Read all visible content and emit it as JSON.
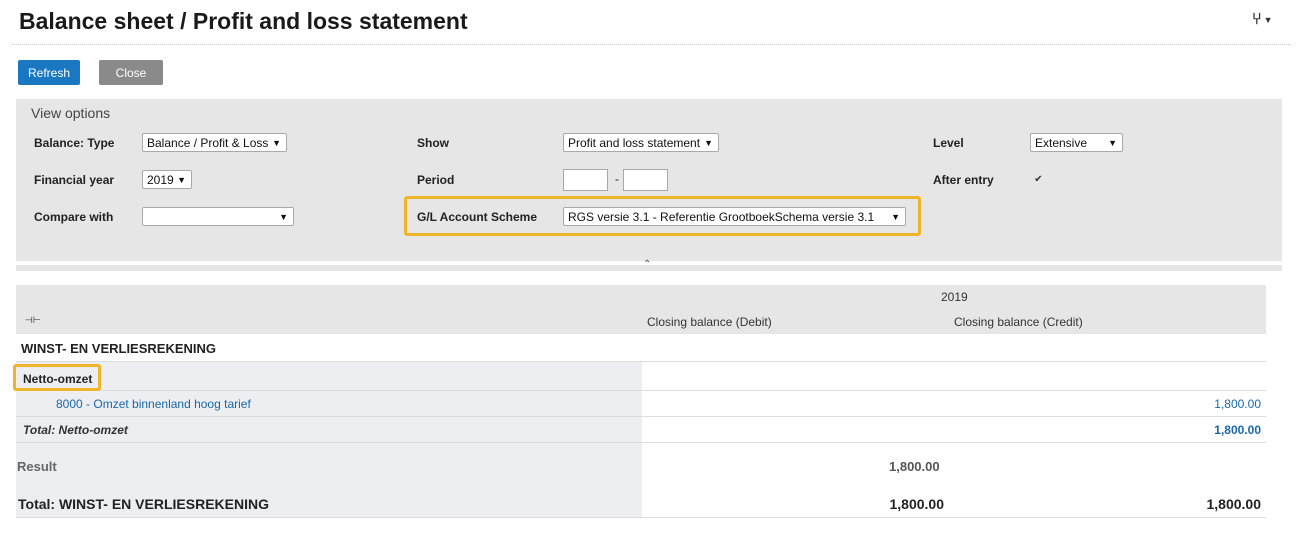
{
  "header": {
    "title": "Balance sheet / Profit and loss statement",
    "tools_icon": "tools-icon"
  },
  "toolbar": {
    "refresh_label": "Refresh",
    "close_label": "Close"
  },
  "view_options": {
    "title": "View options",
    "balance_type": {
      "label": "Balance: Type",
      "value": "Balance / Profit & Loss"
    },
    "financial_year": {
      "label": "Financial year",
      "value": "2019"
    },
    "compare_with": {
      "label": "Compare with",
      "value": ""
    },
    "show": {
      "label": "Show",
      "value": "Profit and loss statement"
    },
    "period": {
      "label": "Period",
      "from": "",
      "to": "",
      "separator": "-"
    },
    "scheme": {
      "label": "G/L Account Scheme",
      "value": "RGS versie 3.1 - Referentie GrootboekSchema versie 3.1"
    },
    "level": {
      "label": "Level",
      "value": "Extensive"
    },
    "after_entry": {
      "label": "After entry",
      "checked": true
    },
    "highlight_color": "#f0b429"
  },
  "table": {
    "year": "2019",
    "col_debit": "Closing balance (Debit)",
    "col_credit": "Closing balance (Credit)",
    "section": "WINST- EN VERLIESREKENING",
    "group": "Netto-omzet",
    "account": {
      "label": "8000 - Omzet binnenland hoog tarief",
      "credit": "1,800.00"
    },
    "group_total": {
      "label": "Total: Netto-omzet",
      "credit": "1,800.00"
    },
    "result": {
      "label": "Result",
      "debit": "1,800.00"
    },
    "section_total": {
      "label": "Total: WINST- EN VERLIESREKENING",
      "debit": "1,800.00",
      "credit": "1,800.00"
    }
  }
}
